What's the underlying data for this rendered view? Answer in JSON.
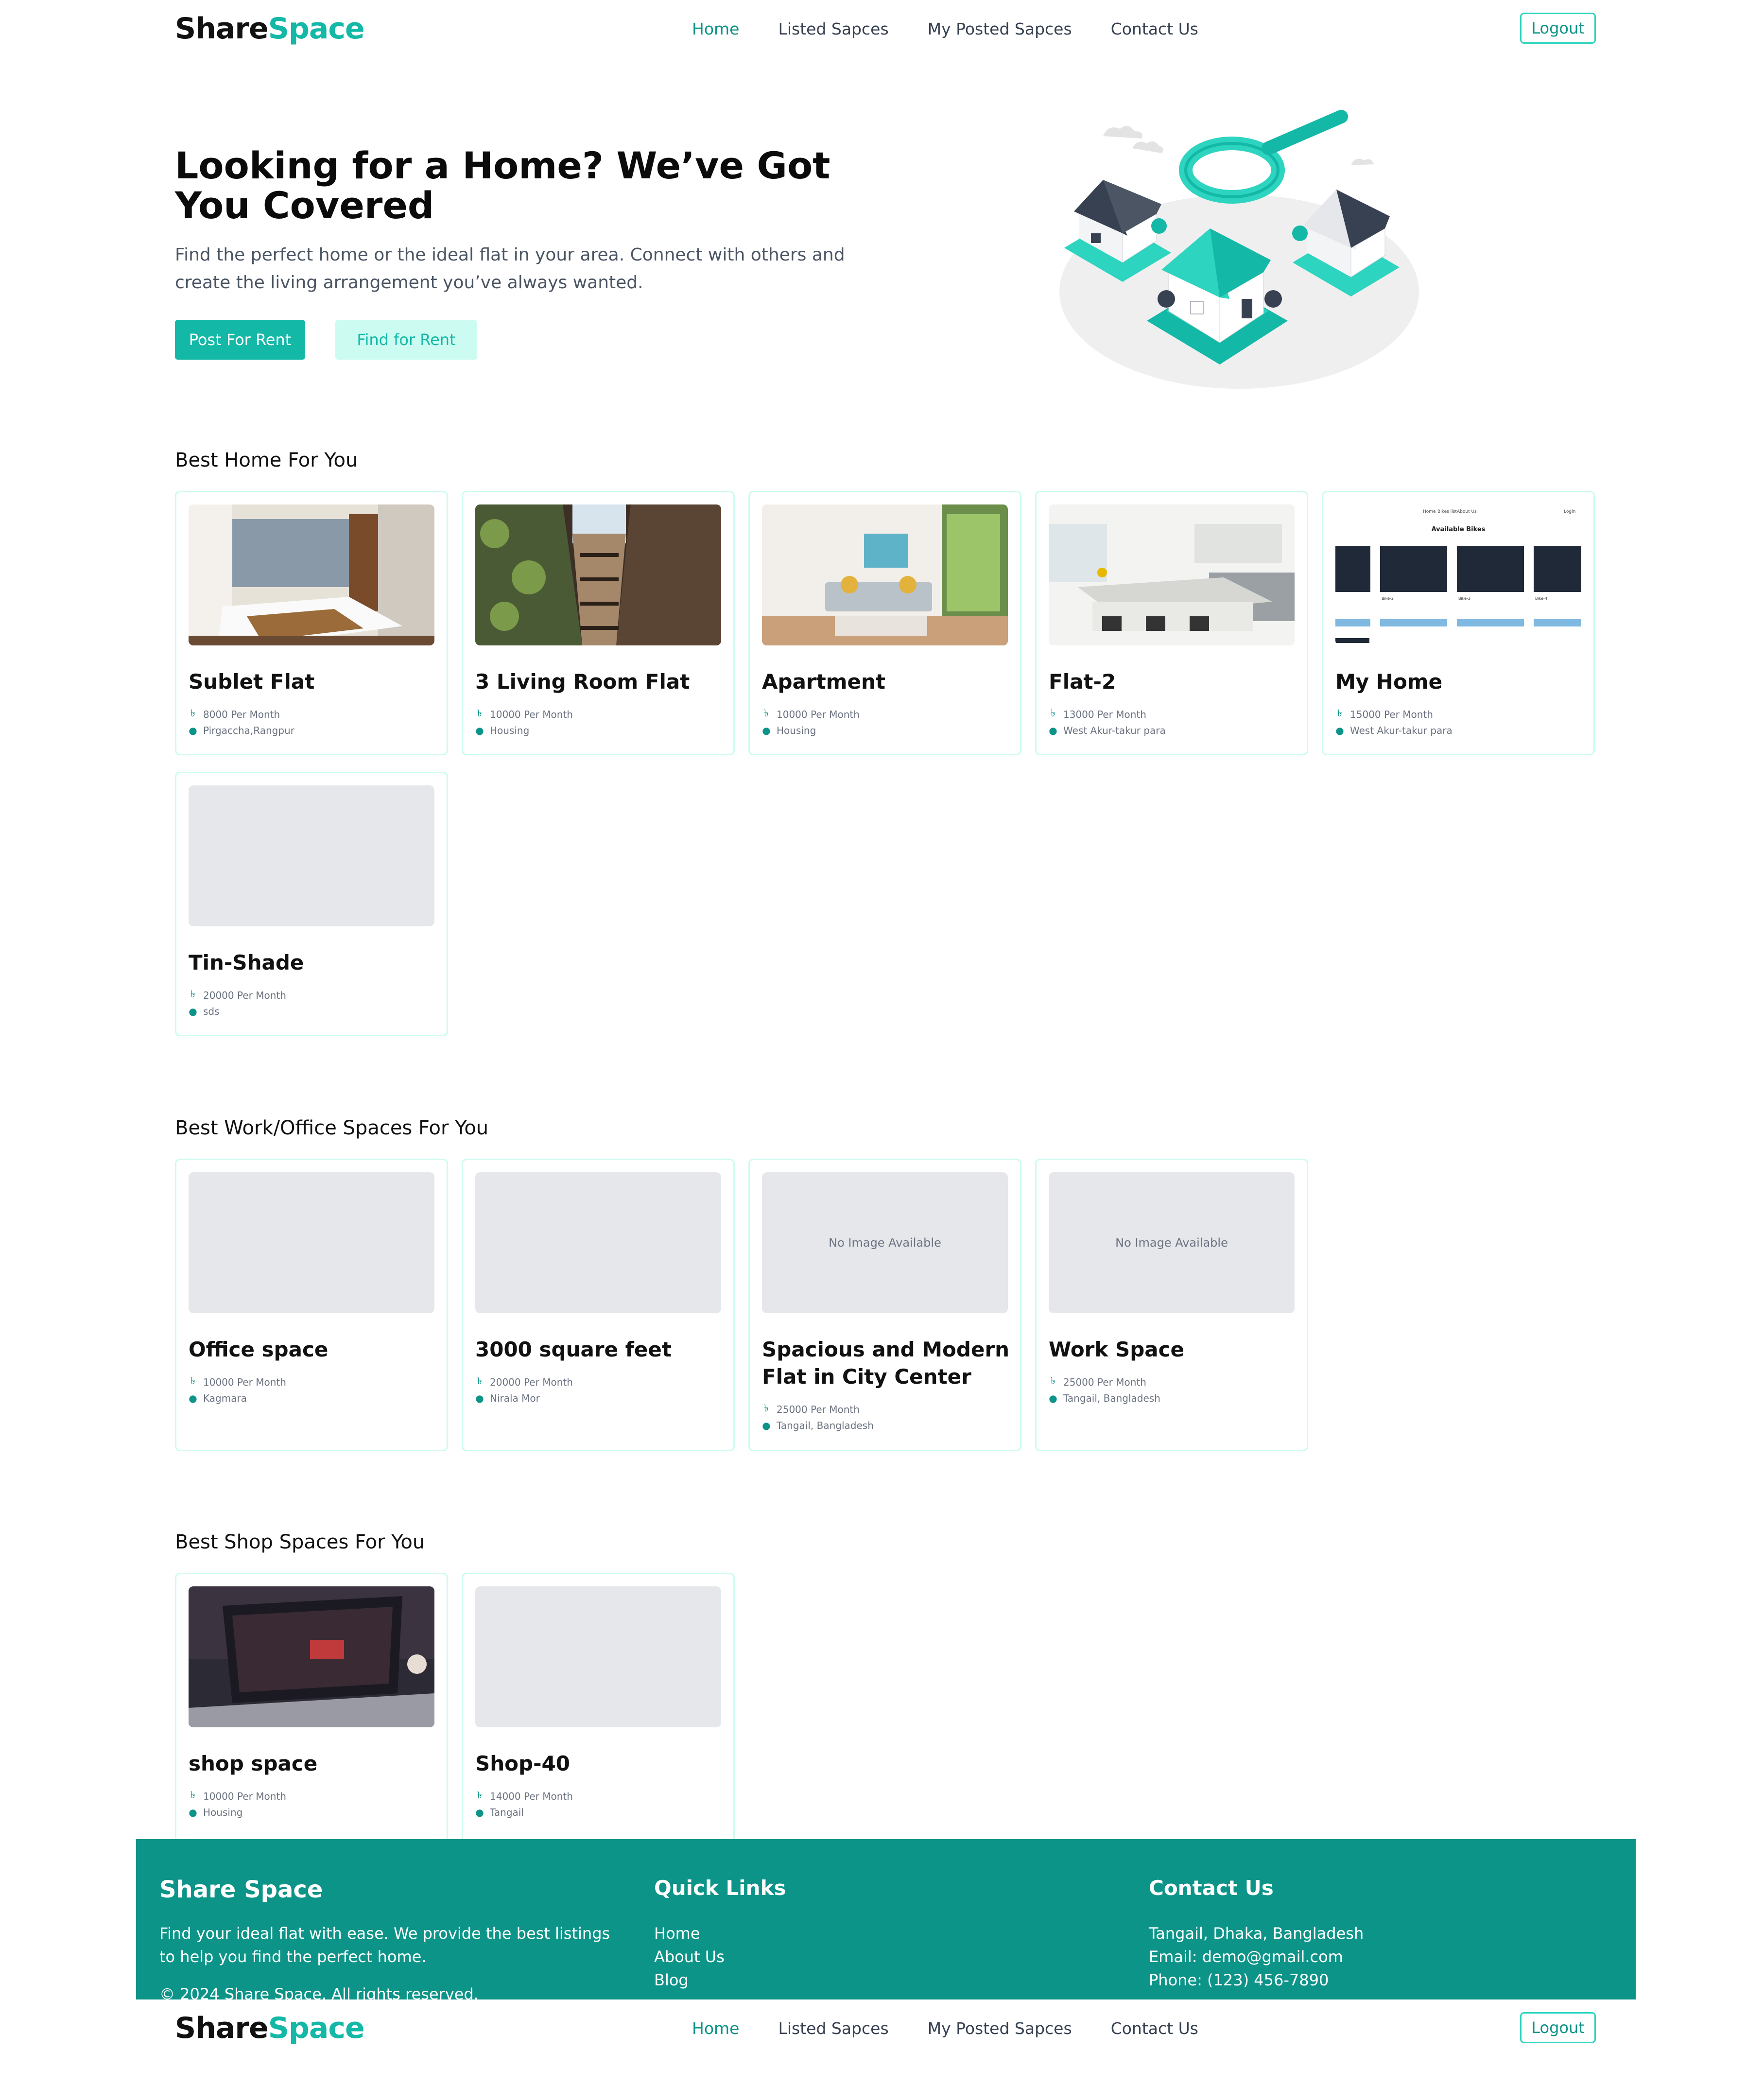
{
  "brand": {
    "part1": "Share",
    "part2": "Space"
  },
  "nav": {
    "home": "Home",
    "listed": "Listed Sapces",
    "posted": "My Posted Sapces",
    "contact": "Contact Us",
    "logout": "Logout"
  },
  "hero": {
    "title": "Looking for a Home? We’ve Got You Covered",
    "subtitle": "Find the perfect home or the ideal flat in your area. Connect with others and create the living arrangement you’ve always wanted.",
    "post_btn": "Post For Rent",
    "find_btn": "Find for Rent"
  },
  "sections": {
    "home": "Best Home For You",
    "work": "Best Work/Office Spaces For You",
    "shop": "Best Shop Spaces For You"
  },
  "home_cards": [
    {
      "title": "Sublet Flat",
      "price": "8000 Per Month",
      "location": "Pirgaccha,Rangpur"
    },
    {
      "title": "3 Living Room Flat",
      "price": "10000 Per Month",
      "location": "Housing"
    },
    {
      "title": "Apartment",
      "price": "10000 Per Month",
      "location": "Housing"
    },
    {
      "title": "Flat-2",
      "price": "13000 Per Month",
      "location": "West Akur-takur para"
    },
    {
      "title": "My Home",
      "price": "15000 Per Month",
      "location": "West Akur-takur para"
    },
    {
      "title": "Tin-Shade",
      "price": "20000 Per Month",
      "location": "sds"
    }
  ],
  "work_cards": [
    {
      "title": "Office space",
      "price": "10000 Per Month",
      "location": "Kagmara"
    },
    {
      "title": "3000 square feet",
      "price": "20000 Per Month",
      "location": "Nirala Mor"
    },
    {
      "title": "Spacious and Modern Flat in City Center",
      "price": "25000 Per Month",
      "location": "Tangail, Bangladesh",
      "image_text": "No Image Available"
    },
    {
      "title": "Work Space",
      "price": "25000 Per Month",
      "location": "Tangail, Bangladesh",
      "image_text": "No Image Available"
    }
  ],
  "shop_cards": [
    {
      "title": "shop space",
      "price": "10000 Per Month",
      "location": "Housing"
    },
    {
      "title": "Shop-40",
      "price": "14000 Per Month",
      "location": "Tangail"
    }
  ],
  "thumb_text": {
    "nav_home": "Home",
    "nav_bikes": "Bikes list",
    "nav_about": "About Us",
    "login": "Login",
    "heading": "Available Bikes",
    "bike2": "Bike-2",
    "bike3": "Bike-3",
    "bike4": "Bike-4"
  },
  "footer": {
    "brand": "Share Space",
    "desc": "Find your ideal flat with ease. We provide the best listings to help you find the perfect home.",
    "copyright": "© 2024 Share Space. All rights reserved.",
    "quick_title": "Quick Links",
    "quick_links": [
      "Home",
      "About Us",
      "Blog"
    ],
    "contact_title": "Contact Us",
    "contact": [
      "Tangail, Dhaka, Bangladesh",
      "Email: demo@gmail.com",
      "Phone: (123) 456-7890"
    ]
  },
  "icons": {
    "price": "taka-icon",
    "location": "map-pin-icon"
  },
  "colors": {
    "accent": "#14b8a6",
    "accent_dark": "#0d9488",
    "accent_light": "#ccfbf1",
    "footer_bg": "#0d9488"
  }
}
